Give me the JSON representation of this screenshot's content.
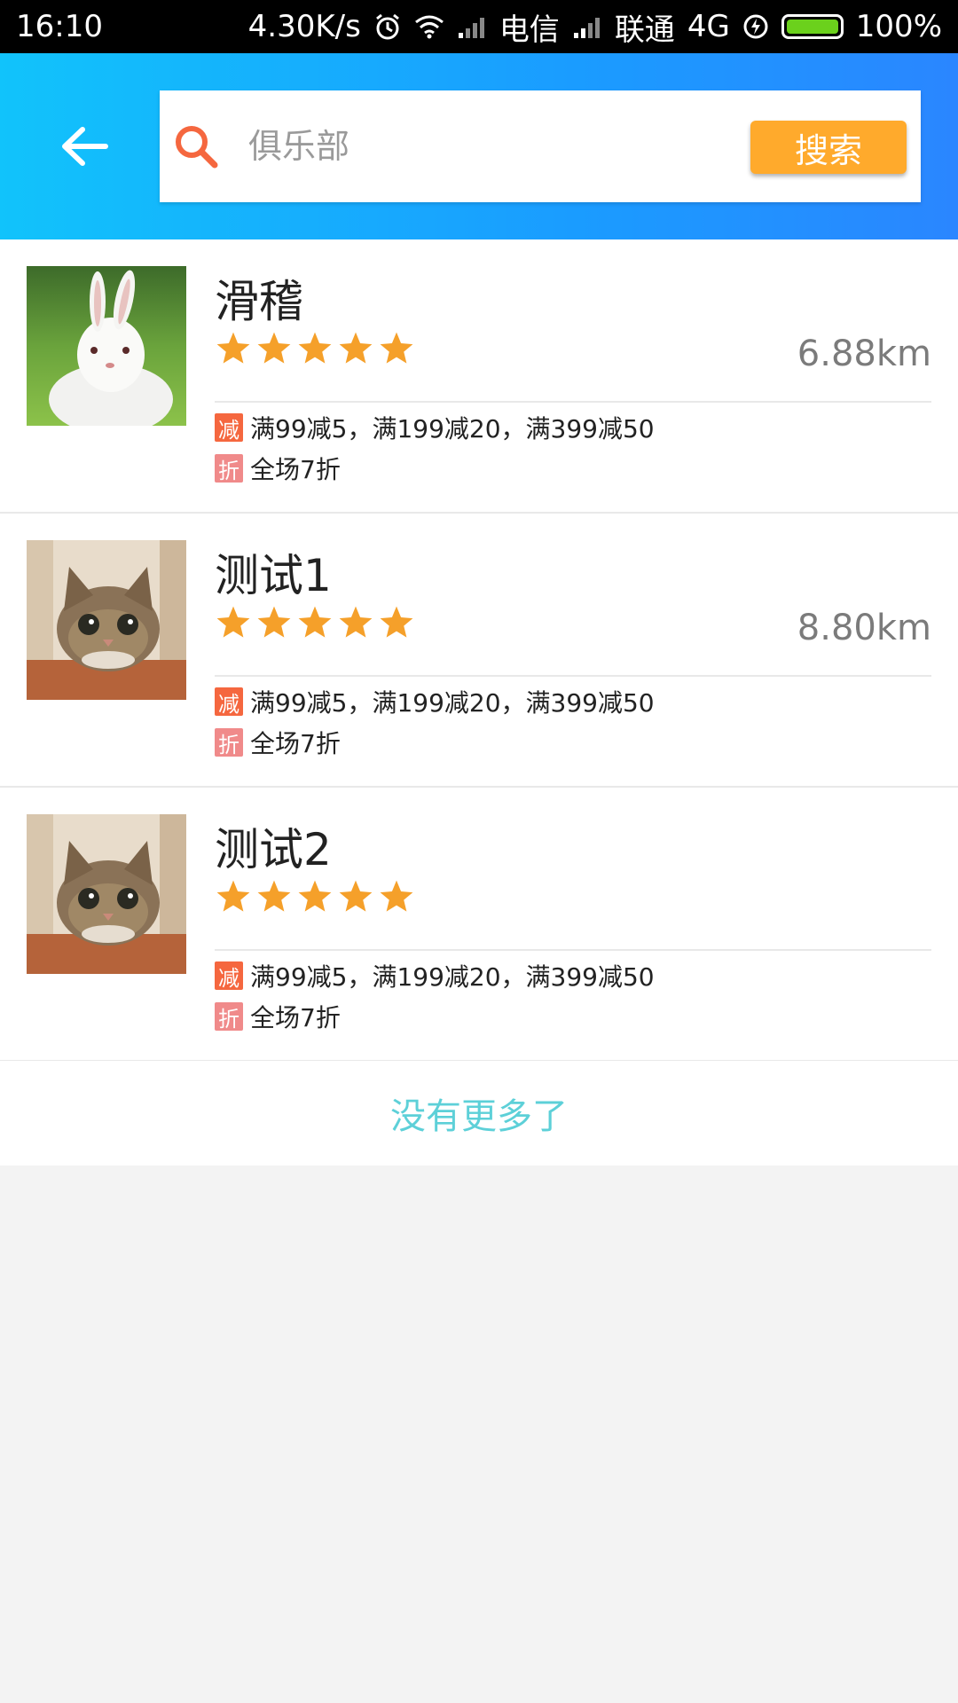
{
  "statusbar": {
    "time": "16:10",
    "speed": "4.30K/s",
    "carrier1": "电信",
    "carrier2": "联通",
    "network": "4G",
    "battery": "100%"
  },
  "header": {
    "search_placeholder": "俱乐部",
    "search_value": "",
    "search_button": "搜索"
  },
  "items": [
    {
      "name": "滑稽",
      "rating": 5,
      "distance": "6.88km",
      "image": "rabbit-photo",
      "promo1_tag": "减",
      "promo1_text": "满99减5，满199减20，满399减50",
      "promo2_tag": "折",
      "promo2_text": "全场7折"
    },
    {
      "name": "测试1",
      "rating": 5,
      "distance": "8.80km",
      "image": "cat-photo",
      "promo1_tag": "减",
      "promo1_text": "满99减5，满199减20，满399减50",
      "promo2_tag": "折",
      "promo2_text": "全场7折"
    },
    {
      "name": "测试2",
      "rating": 5,
      "distance": "",
      "image": "cat-photo",
      "promo1_tag": "减",
      "promo1_text": "满99减5，满199减20，满399减50",
      "promo2_tag": "折",
      "promo2_text": "全场7折"
    }
  ],
  "footer": {
    "text": "没有更多了"
  },
  "colors": {
    "header_start": "#11c3fb",
    "header_end": "#2a86ff",
    "accent": "#ffaa2c",
    "star": "#f5a02a"
  }
}
